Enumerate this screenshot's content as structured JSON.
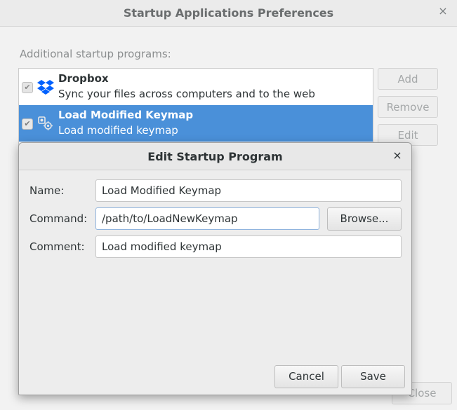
{
  "window": {
    "title": "Startup Applications Preferences",
    "close_glyph": "×",
    "section_label": "Additional startup programs:",
    "buttons": {
      "add": "Add",
      "remove": "Remove",
      "edit": "Edit",
      "close": "Close"
    }
  },
  "programs": [
    {
      "name": "Dropbox",
      "description": "Sync your files across computers and to the web",
      "enabled": true,
      "icon": "dropbox-icon",
      "selected": false
    },
    {
      "name": "Load Modified Keymap",
      "description": "Load modified keymap",
      "enabled": true,
      "icon": "gears-icon",
      "selected": true
    }
  ],
  "dialog": {
    "title": "Edit Startup Program",
    "close_glyph": "×",
    "name_label": "Name:",
    "name_value": "Load Modified Keymap",
    "command_label": "Command:",
    "command_value": "/path/to/LoadNewKeymap",
    "comment_label": "Comment:",
    "comment_value": "Load modified keymap",
    "browse_label": "Browse...",
    "cancel_label": "Cancel",
    "save_label": "Save"
  },
  "colors": {
    "selection": "#4a90d9",
    "dropbox_blue": "#0061fe"
  }
}
